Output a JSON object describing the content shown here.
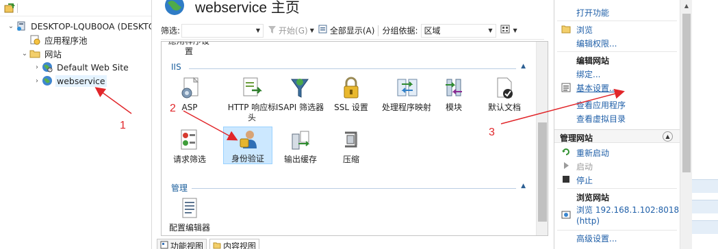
{
  "tree": {
    "server": "DESKTOP-LQUB0OA (DESKTO",
    "app_pools": "应用程序池",
    "sites": "网站",
    "default_site": "Default Web Site",
    "webservice": "webservice"
  },
  "center": {
    "title": "webservice 主页",
    "filter": {
      "label": "筛选:",
      "start_label": "开始(G)",
      "show_all_label": "全部显示(A)",
      "group_by_label": "分组依据:",
      "group_by_value": "区域"
    },
    "partial_top": [
      "應用稈序设",
      "置"
    ],
    "groups": {
      "iis": "IIS",
      "manage": "管理"
    },
    "features_row1": [
      {
        "label": "ASP",
        "icon": "asp-icon"
      },
      {
        "label": "HTTP 响应标头",
        "icon": "http-response-headers-icon"
      },
      {
        "label": "ISAPI 筛选器",
        "icon": "isapi-filters-icon"
      },
      {
        "label": "SSL 设置",
        "icon": "ssl-lock-icon"
      },
      {
        "label": "处理程序映射",
        "icon": "handler-mappings-icon"
      },
      {
        "label": "模块",
        "icon": "modules-icon"
      },
      {
        "label": "默认文档",
        "icon": "default-document-icon"
      }
    ],
    "features_row2": [
      {
        "label": "请求筛选",
        "icon": "request-filtering-icon"
      },
      {
        "label": "身份验证",
        "icon": "authentication-icon"
      },
      {
        "label": "输出缓存",
        "icon": "output-caching-icon"
      },
      {
        "label": "压缩",
        "icon": "compression-icon"
      }
    ],
    "manage_features": [
      {
        "label": "配置编辑器",
        "icon": "configuration-editor-icon"
      }
    ],
    "tabs": {
      "features_view": "功能视图",
      "content_view": "内容视图"
    }
  },
  "actions": {
    "open_feature": "打开功能",
    "browse": "浏览",
    "edit_permissions": "编辑权限...",
    "edit_site_header": "编辑网站",
    "bindings": "绑定...",
    "basic_settings": "基本设置...",
    "view_applications": "查看应用程序",
    "view_virtual_dirs": "查看虚拟目录",
    "manage_site_header": "管理网站",
    "restart": "重新启动",
    "start": "启动",
    "stop": "停止",
    "browse_site_header": "浏览网站",
    "browse_url": "浏览 192.168.1.102:8018",
    "browse_url_scheme": "(http)",
    "advanced_settings": "高级设置..."
  },
  "annotations": [
    "1",
    "2",
    "3"
  ],
  "colors": {
    "link": "#1f5fa8",
    "annotation": "#e1262a",
    "group_header": "#1a5e9c",
    "selection": "#cce8ff"
  }
}
